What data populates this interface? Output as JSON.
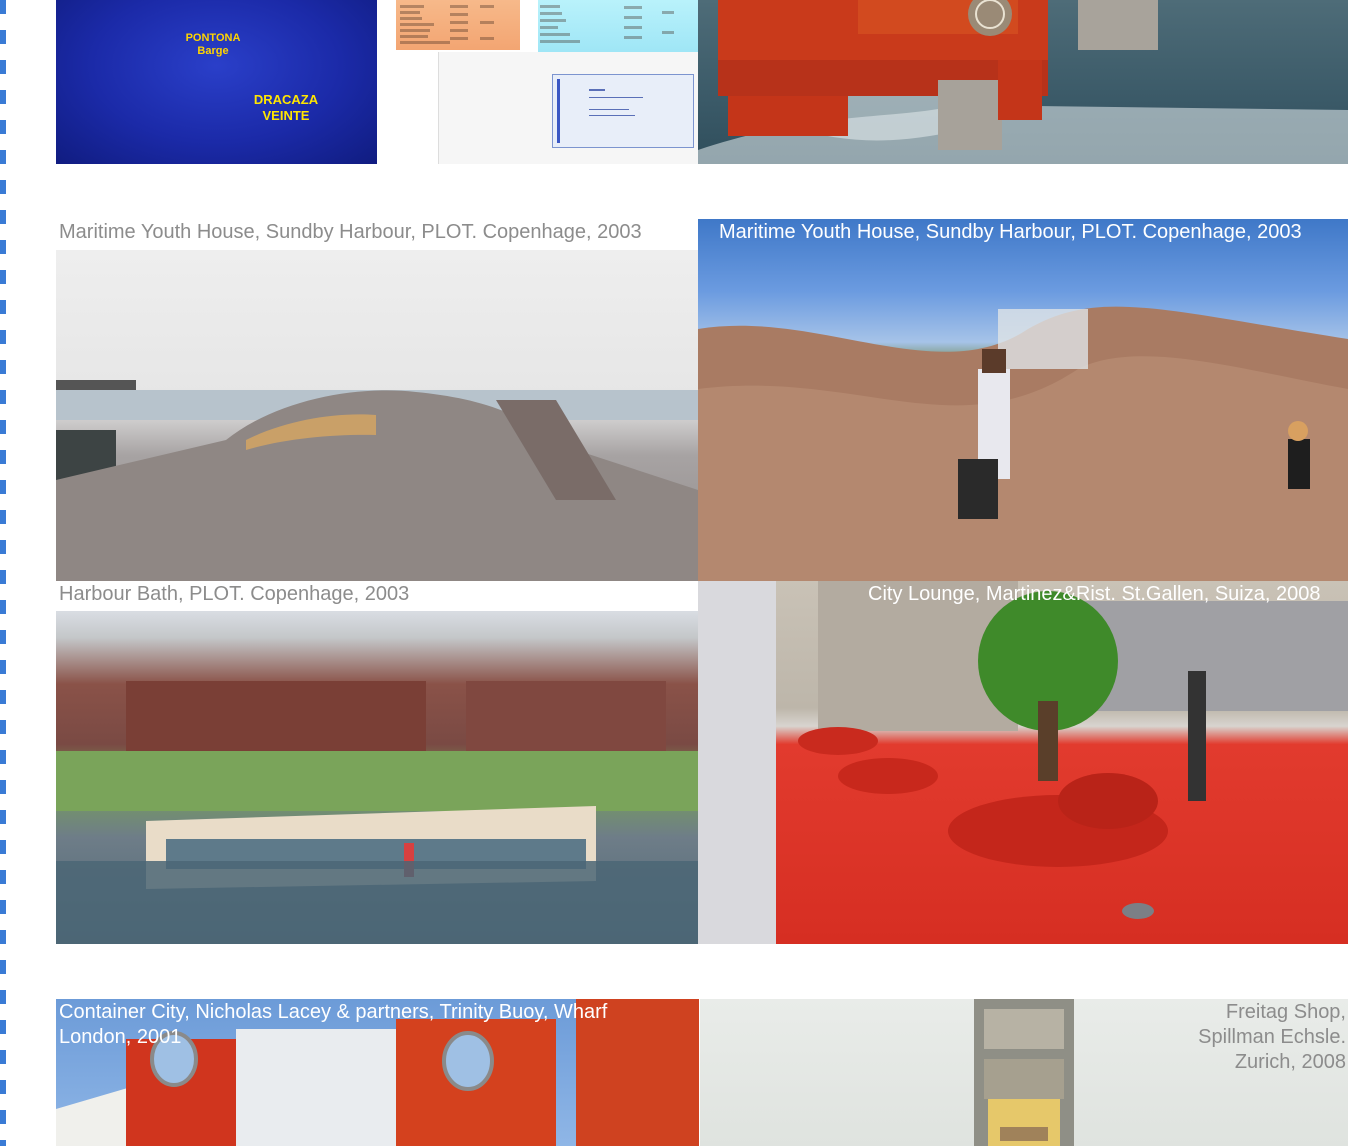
{
  "barge_slide": {
    "label_es": "PONTONA",
    "label_en": "Barge",
    "name_line1": "DRACAZA",
    "name_line2": "VEINTE"
  },
  "captions": {
    "youth_house_left": "Maritime Youth House, Sundby Harbour, PLOT.  Copenhage, 2003",
    "youth_house_right": "Maritime Youth House, Sundby Harbour, PLOT.  Copenhage, 2003",
    "harbour_bath": "Harbour Bath, PLOT. Copenhage, 2003",
    "city_lounge": "City Lounge, Martinez&Rist. St.Gallen, Suiza, 2008",
    "container_city_line1": "Container City, Nicholas Lacey & partners, Trinity Buoy, Wharf",
    "container_city_line2": "London, 2001",
    "freitag_line1": "Freitag Shop,",
    "freitag_line2": "Spillman Echsle.",
    "freitag_line3": "Zurich, 2008"
  },
  "colors": {
    "guide_blue": "#3a7bd5",
    "caption_grey": "#8c8c8c",
    "barge_text_yellow": "#ffd400",
    "lounge_red": "#e23b2e"
  }
}
